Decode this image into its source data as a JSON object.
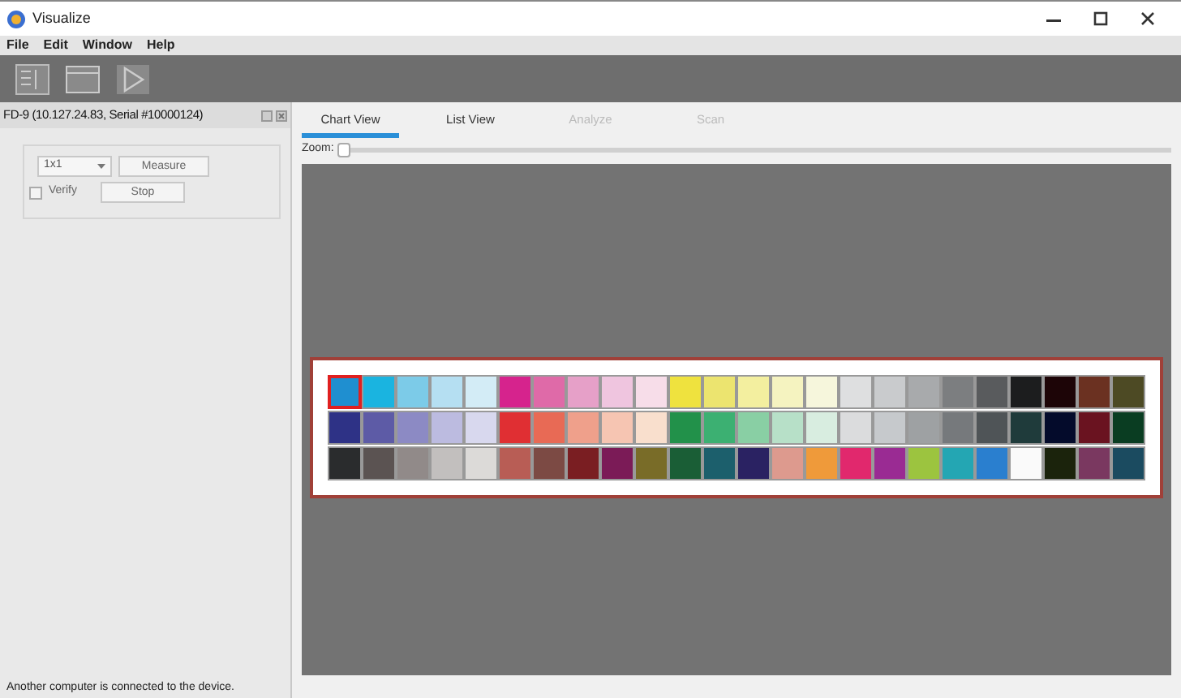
{
  "window": {
    "title": "Visualize"
  },
  "menu": [
    "File",
    "Edit",
    "Window",
    "Help"
  ],
  "panel": {
    "title": "FD-9 (10.127.24.83, Serial #10000124)",
    "size_select": "1x1",
    "measure_button": "Measure",
    "verify": {
      "label": "Verify",
      "checked": false
    },
    "stop_button": "Stop"
  },
  "tabs": [
    {
      "label": "Chart View",
      "selected": true,
      "disabled": false
    },
    {
      "label": "List View",
      "selected": false,
      "disabled": false
    },
    {
      "label": "Analyze",
      "selected": false,
      "disabled": true
    },
    {
      "label": "Scan",
      "selected": false,
      "disabled": true
    }
  ],
  "zoom": {
    "label": "Zoom:",
    "level": 0
  },
  "swatch_rows": [
    [
      {
        "color": "#1f8fd0",
        "selected": true
      },
      {
        "color": "#1ab4e0",
        "selected": false
      },
      {
        "color": "#7ccbe8",
        "selected": false
      },
      {
        "color": "#b5dff2",
        "selected": false
      },
      {
        "color": "#d3ecf6",
        "selected": false
      },
      {
        "color": "#d6238d",
        "selected": false
      },
      {
        "color": "#df6aa8",
        "selected": false
      },
      {
        "color": "#e6a0c8",
        "selected": false
      },
      {
        "color": "#efc5df",
        "selected": false
      },
      {
        "color": "#f7dde9",
        "selected": false
      },
      {
        "color": "#efe23e",
        "selected": false
      },
      {
        "color": "#ece46f",
        "selected": false
      },
      {
        "color": "#f3ef9f",
        "selected": false
      },
      {
        "color": "#f5f3c0",
        "selected": false
      },
      {
        "color": "#f6f6dc",
        "selected": false
      },
      {
        "color": "#dedfe0",
        "selected": false
      },
      {
        "color": "#c9cbcd",
        "selected": false
      },
      {
        "color": "#a8aaac",
        "selected": false
      },
      {
        "color": "#7c7e80",
        "selected": false
      },
      {
        "color": "#595b5d",
        "selected": false
      },
      {
        "color": "#1c1d1e",
        "selected": false
      },
      {
        "color": "#1d0507",
        "selected": false
      },
      {
        "color": "#6b3121",
        "selected": false
      },
      {
        "color": "#4d4a24",
        "selected": false
      }
    ],
    [
      {
        "color": "#2e3286",
        "selected": false
      },
      {
        "color": "#5d5ba6",
        "selected": false
      },
      {
        "color": "#8c8ac4",
        "selected": false
      },
      {
        "color": "#bcbbe0",
        "selected": false
      },
      {
        "color": "#d8d8ee",
        "selected": false
      },
      {
        "color": "#e02f33",
        "selected": false
      },
      {
        "color": "#e86a55",
        "selected": false
      },
      {
        "color": "#efa08b",
        "selected": false
      },
      {
        "color": "#f6c5b2",
        "selected": false
      },
      {
        "color": "#f9dfcd",
        "selected": false
      },
      {
        "color": "#22914a",
        "selected": false
      },
      {
        "color": "#3cb072",
        "selected": false
      },
      {
        "color": "#89cfa4",
        "selected": false
      },
      {
        "color": "#b7e0c8",
        "selected": false
      },
      {
        "color": "#d8ede0",
        "selected": false
      },
      {
        "color": "#dbdcdd",
        "selected": false
      },
      {
        "color": "#c6c9cc",
        "selected": false
      },
      {
        "color": "#9ea1a3",
        "selected": false
      },
      {
        "color": "#76797c",
        "selected": false
      },
      {
        "color": "#4f5457",
        "selected": false
      },
      {
        "color": "#1f3b3b",
        "selected": false
      },
      {
        "color": "#040b2b",
        "selected": false
      },
      {
        "color": "#6a1320",
        "selected": false
      },
      {
        "color": "#0a3d22",
        "selected": false
      }
    ],
    [
      {
        "color": "#2a2c2d",
        "selected": false
      },
      {
        "color": "#5b5352",
        "selected": false
      },
      {
        "color": "#918a89",
        "selected": false
      },
      {
        "color": "#c2bfbe",
        "selected": false
      },
      {
        "color": "#dcdad8",
        "selected": false
      },
      {
        "color": "#b85d55",
        "selected": false
      },
      {
        "color": "#7c4a44",
        "selected": false
      },
      {
        "color": "#7a1e22",
        "selected": false
      },
      {
        "color": "#7b1b57",
        "selected": false
      },
      {
        "color": "#796c28",
        "selected": false
      },
      {
        "color": "#1a5e36",
        "selected": false
      },
      {
        "color": "#1c5f6c",
        "selected": false
      },
      {
        "color": "#2a2262",
        "selected": false
      },
      {
        "color": "#dd9a8e",
        "selected": false
      },
      {
        "color": "#ef9a3a",
        "selected": false
      },
      {
        "color": "#e1286d",
        "selected": false
      },
      {
        "color": "#9a2b93",
        "selected": false
      },
      {
        "color": "#9cc43f",
        "selected": false
      },
      {
        "color": "#24a6b3",
        "selected": false
      },
      {
        "color": "#2a7fcf",
        "selected": false
      },
      {
        "color": "#fafafa",
        "selected": false
      },
      {
        "color": "#1b230c",
        "selected": false
      },
      {
        "color": "#7a3860",
        "selected": false
      },
      {
        "color": "#1b4b60",
        "selected": false
      }
    ]
  ],
  "status_bar": "Another computer is connected to the device."
}
